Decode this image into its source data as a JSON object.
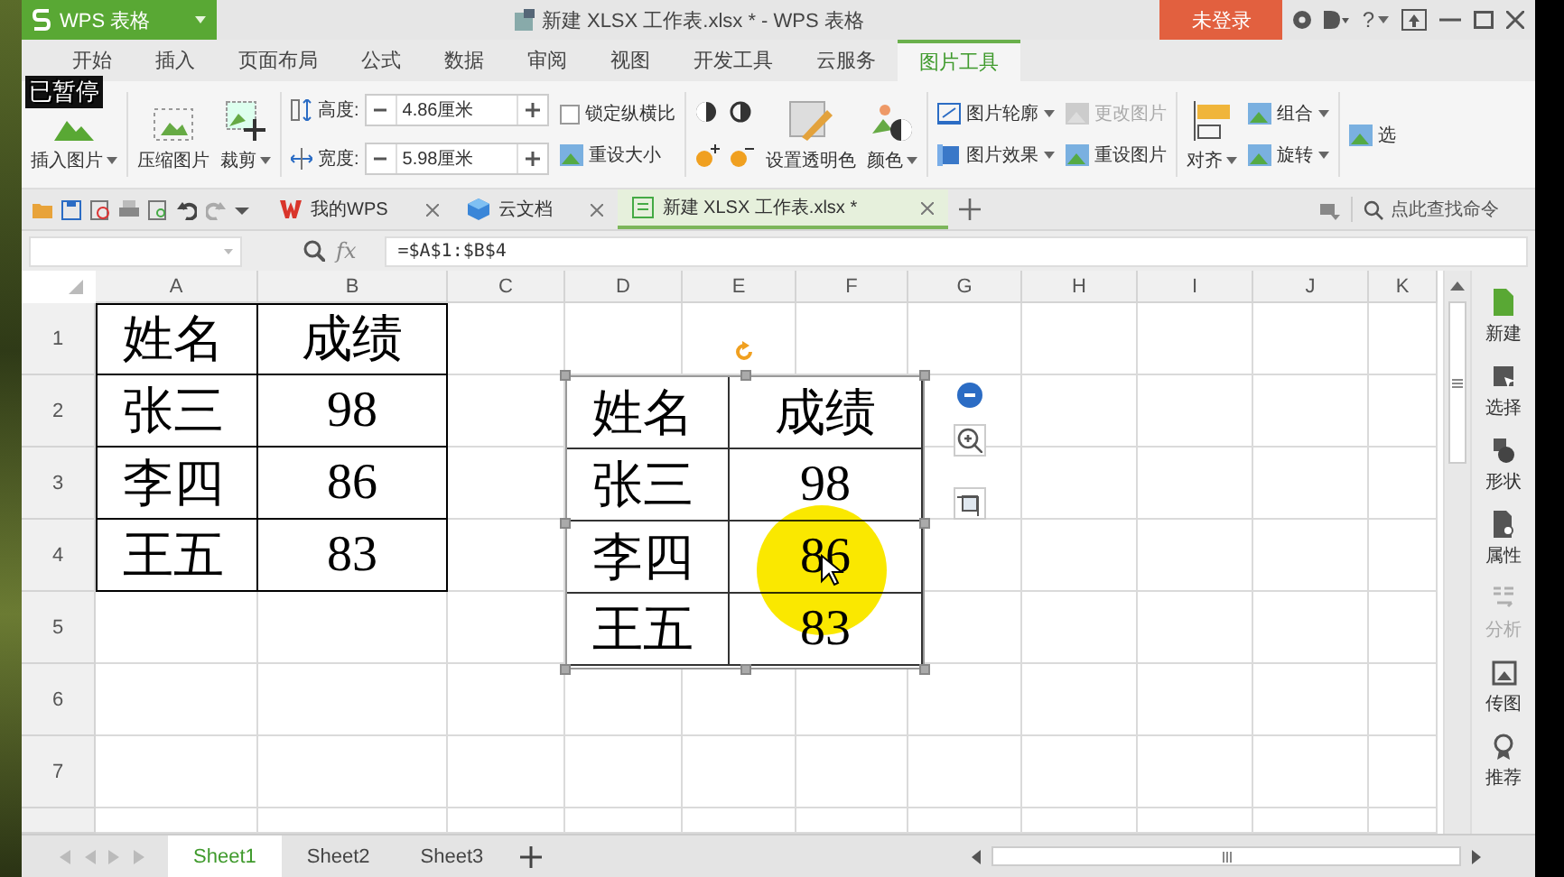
{
  "overlay_text": "已暂停",
  "app_button": {
    "label": "WPS 表格",
    "dropdown": true
  },
  "window": {
    "title": "新建 XLSX 工作表.xlsx * - WPS 表格",
    "help": "?"
  },
  "login_button": {
    "label": "未登录"
  },
  "menu_tabs": [
    {
      "label": "开始",
      "selected": false
    },
    {
      "label": "插入",
      "selected": false
    },
    {
      "label": "页面布局",
      "selected": false
    },
    {
      "label": "公式",
      "selected": false
    },
    {
      "label": "数据",
      "selected": false
    },
    {
      "label": "审阅",
      "selected": false
    },
    {
      "label": "视图",
      "selected": false
    },
    {
      "label": "开发工具",
      "selected": false
    },
    {
      "label": "云服务",
      "selected": false
    },
    {
      "label": "图片工具",
      "selected": true
    }
  ],
  "ribbon": [
    {
      "kind": "big",
      "label": "插入图片",
      "dropdown": true
    },
    {
      "kind": "big",
      "label": "压缩图片",
      "dropdown": false
    },
    {
      "kind": "big",
      "label": "裁剪",
      "dropdown": true
    },
    {
      "kind": "fields",
      "fields": [
        {
          "label": "高度:",
          "value": "4.86厘米"
        },
        {
          "label": "宽度:",
          "value": "5.98厘米"
        }
      ]
    },
    {
      "kind": "stack",
      "items": [
        {
          "kind": "checkbox",
          "label": "锁定纵横比",
          "checked": false
        },
        {
          "kind": "button",
          "label": "重设大小",
          "dropdown": false,
          "disabled": false
        }
      ]
    },
    {
      "kind": "adjust"
    },
    {
      "kind": "big",
      "label": "设置透明色",
      "dropdown": false
    },
    {
      "kind": "big",
      "label": "颜色",
      "dropdown": true
    },
    {
      "kind": "stack",
      "items": [
        {
          "kind": "button",
          "label": "图片轮廓",
          "dropdown": true,
          "disabled": false
        },
        {
          "kind": "button",
          "label": "图片效果",
          "dropdown": true,
          "disabled": false
        }
      ]
    },
    {
      "kind": "stack",
      "items": [
        {
          "kind": "button",
          "label": "更改图片",
          "dropdown": false,
          "disabled": true
        },
        {
          "kind": "button",
          "label": "重设图片",
          "dropdown": false,
          "disabled": false
        }
      ]
    },
    {
      "kind": "big",
      "label": "对齐",
      "dropdown": true
    },
    {
      "kind": "stack",
      "items": [
        {
          "kind": "button",
          "label": "组合",
          "dropdown": true,
          "disabled": false
        },
        {
          "kind": "button",
          "label": "旋转",
          "dropdown": true,
          "disabled": false
        }
      ]
    },
    {
      "kind": "stack",
      "items": [
        {
          "kind": "button",
          "label": "选",
          "dropdown": false,
          "disabled": false
        }
      ]
    }
  ],
  "doc_tabs": [
    {
      "label": "我的WPS",
      "kind": "wps",
      "selected": false
    },
    {
      "label": "云文档",
      "kind": "cloud",
      "selected": false
    },
    {
      "label": "新建 XLSX 工作表.xlsx *",
      "kind": "sheet",
      "selected": true
    }
  ],
  "search": {
    "placeholder": "点此查找命令"
  },
  "formula_bar": {
    "fx": "fx",
    "formula": "=$A$1:$B$4"
  },
  "columns": [
    "A",
    "B",
    "C",
    "D",
    "E",
    "F",
    "G",
    "H",
    "I",
    "J",
    "K"
  ],
  "rows": [
    "1",
    "2",
    "3",
    "4",
    "5",
    "6",
    "7"
  ],
  "cells": [
    [
      "姓名",
      "成绩"
    ],
    [
      "张三",
      "98"
    ],
    [
      "李四",
      "86"
    ],
    [
      "王五",
      "83"
    ]
  ],
  "picture": {
    "selected": true,
    "rows": [
      [
        "姓名",
        "成绩"
      ],
      [
        "张三",
        "98"
      ],
      [
        "李四",
        "86"
      ],
      [
        "王五",
        "83"
      ]
    ]
  },
  "sidebar": [
    {
      "label": "新建",
      "kind": "new",
      "disabled": false
    },
    {
      "label": "选择",
      "kind": "select",
      "disabled": false
    },
    {
      "label": "形状",
      "kind": "shape",
      "disabled": false
    },
    {
      "label": "属性",
      "kind": "property",
      "disabled": false
    },
    {
      "label": "分析",
      "kind": "analyze",
      "disabled": true
    },
    {
      "label": "传图",
      "kind": "upload",
      "disabled": false
    },
    {
      "label": "推荐",
      "kind": "recommend",
      "disabled": false
    }
  ],
  "sheet_tabs": [
    {
      "label": "Sheet1",
      "selected": true
    },
    {
      "label": "Sheet2",
      "selected": false
    },
    {
      "label": "Sheet3",
      "selected": false
    }
  ]
}
